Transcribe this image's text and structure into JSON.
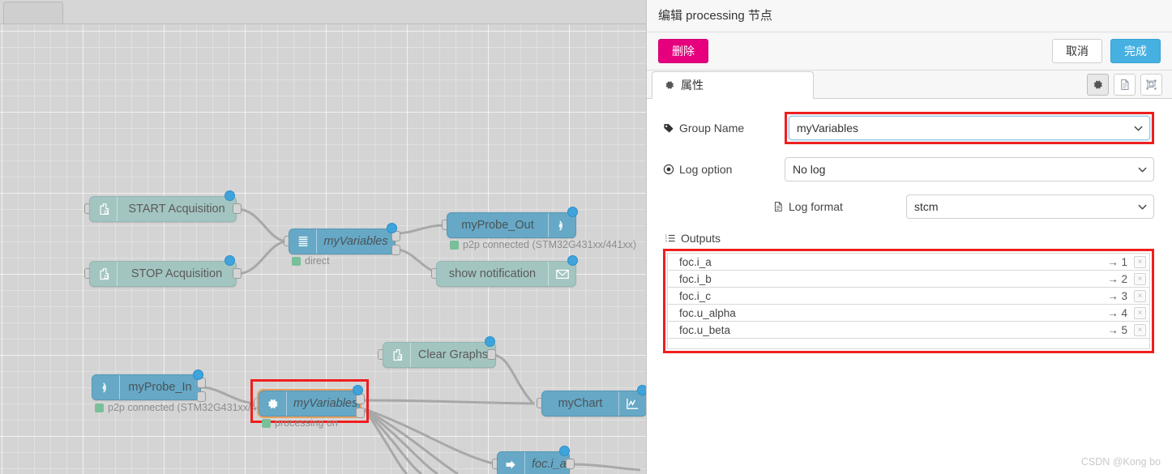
{
  "panel": {
    "title": "编辑 processing 节点",
    "delete_label": "删除",
    "cancel_label": "取消",
    "done_label": "完成",
    "tab_label": "属性",
    "tools": [
      {
        "name": "gear-icon",
        "active": true
      },
      {
        "name": "document-icon",
        "active": false
      },
      {
        "name": "layers-icon",
        "active": false
      }
    ],
    "form": {
      "group_name_label": "Group Name",
      "group_name_value": "myVariables",
      "log_option_label": "Log option",
      "log_option_value": "No log",
      "log_format_label": "Log format",
      "log_format_value": "stcm"
    },
    "outputs": {
      "label": "Outputs",
      "rows": [
        {
          "name": "foc.i_a",
          "index": "→ 1",
          "delete": "×"
        },
        {
          "name": "foc.i_b",
          "index": "→ 2",
          "delete": "×"
        },
        {
          "name": "foc.i_c",
          "index": "→ 3",
          "delete": "×"
        },
        {
          "name": "foc.u_alpha",
          "index": "→ 4",
          "delete": "×"
        },
        {
          "name": "foc.u_beta",
          "index": "→ 5",
          "delete": "×"
        }
      ]
    }
  },
  "canvas": {
    "nodes": {
      "start_acquisition": "START Acquisition",
      "stop_acquisition": "STOP Acquisition",
      "my_variables_top": "myVariables",
      "my_variables_top_status": "direct",
      "my_probe_out": "myProbe_Out",
      "my_probe_out_status": "p2p connected (STM32G431xx/441xx)",
      "show_notification": "show notification",
      "clear_graphs": "Clear Graphs",
      "my_probe_in": "myProbe_In",
      "my_probe_in_status": "p2p connected (STM32G431xx/4",
      "my_variables_sel": "myVariables",
      "my_variables_sel_status": "processing on",
      "my_chart": "myChart",
      "foc_i_a": "foc.i_a"
    }
  },
  "watermark": "CSDN @Kong bo",
  "colors": {
    "accent_pink": "#e6007e",
    "accent_blue": "#46b1e1",
    "node_blue": "#66a8c6",
    "node_teal": "#a3c5c1",
    "highlight_red": "#f01e1e"
  }
}
